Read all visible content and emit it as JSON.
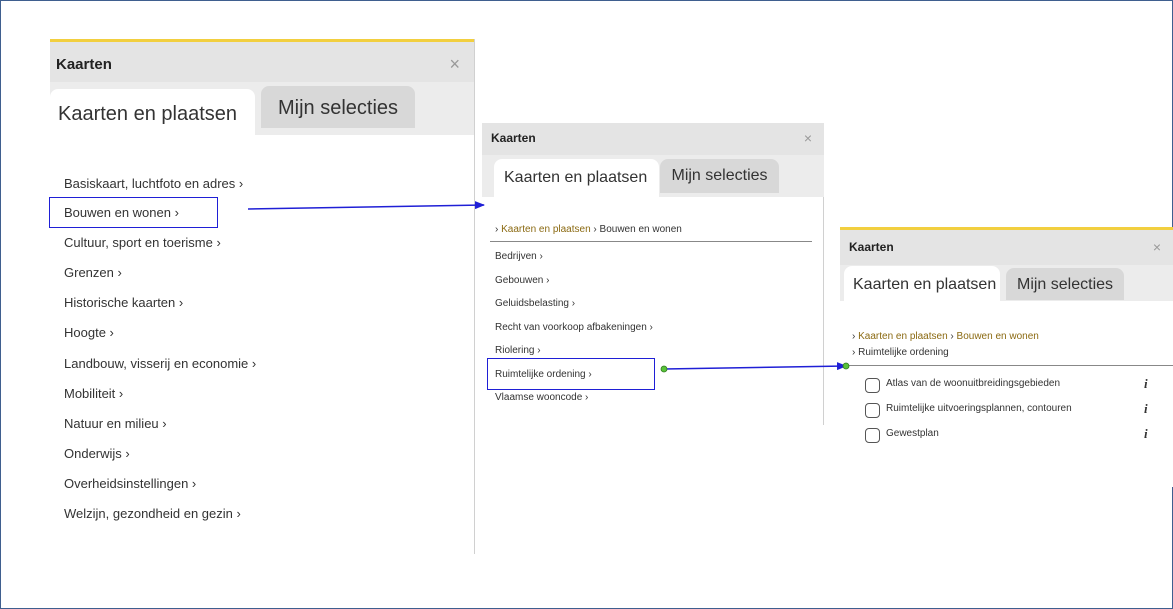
{
  "colors": {
    "accent_bar": "#f2cf3f",
    "highlight": "#1f1fd6",
    "arrow": "#1f1fd6",
    "breadcrumb_link": "#8b6a12",
    "dot": "#59c23a"
  },
  "panel1": {
    "title": "Kaarten",
    "close": "×",
    "tabs": [
      "Kaarten en plaatsen",
      "Mijn selecties"
    ],
    "items": [
      "Basiskaart, luchtfoto en adres ›",
      "Bouwen en wonen ›",
      "Cultuur, sport en toerisme ›",
      "Grenzen ›",
      "Historische kaarten ›",
      "Hoogte ›",
      "Landbouw, visserij en economie ›",
      "Mobiliteit ›",
      "Natuur en milieu ›",
      "Onderwijs ›",
      "Overheidsinstellingen ›",
      "Welzijn, gezondheid en gezin ›"
    ]
  },
  "panel2": {
    "title": "Kaarten",
    "close": "×",
    "tabs": [
      "Kaarten en plaatsen",
      "Mijn selecties"
    ],
    "breadcrumb": {
      "prefix": "›",
      "link": "Kaarten en plaatsen",
      "sep": "›",
      "current": "Bouwen en wonen"
    },
    "items": [
      "Bedrijven ›",
      "Gebouwen ›",
      "Geluidsbelasting ›",
      "Recht van voorkoop afbakeningen ›",
      "Riolering ›",
      "Ruimtelijke ordening ›",
      "Vlaamse wooncode ›"
    ]
  },
  "panel3": {
    "title": "Kaarten",
    "close": "×",
    "tabs": [
      "Kaarten en plaatsen",
      "Mijn selecties"
    ],
    "breadcrumb": {
      "prefix": "›",
      "link1": "Kaarten en plaatsen",
      "sep": "›",
      "link2": "Bouwen en wonen",
      "prefix2": "›",
      "current": "Ruimtelijke ordening"
    },
    "options": [
      {
        "label": "Atlas van de woonuitbreidingsgebieden",
        "info": "i"
      },
      {
        "label": "Ruimtelijke uitvoeringsplannen, contouren",
        "info": "i"
      },
      {
        "label": "Gewestplan",
        "info": "i"
      }
    ]
  }
}
